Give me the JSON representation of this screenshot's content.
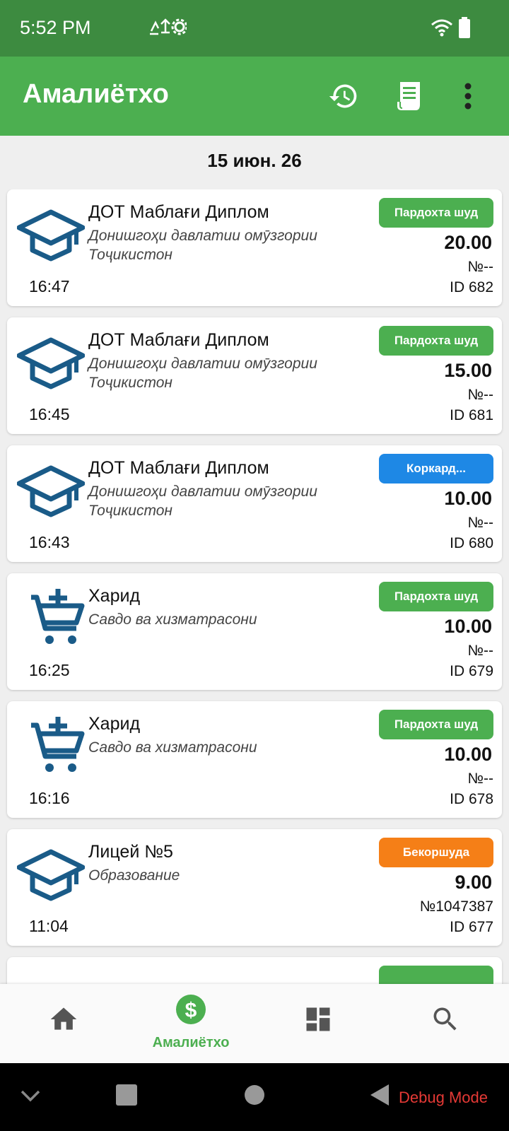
{
  "status_bar": {
    "time": "5:52 PM"
  },
  "app_bar": {
    "title": "Амалиётхо"
  },
  "date_header": "15 июн. 26",
  "colors": {
    "paid": "#4caf50",
    "processing": "#1e88e5",
    "cancelled": "#f57f17",
    "icon_blue": "#1a5b88"
  },
  "transactions": [
    {
      "icon": "graduation-cap-icon",
      "title": "ДОТ Маблағи Диплом",
      "subtitle": "Донишгоҳи давлатии омӯзгории Тоҷикистон",
      "time": "16:47",
      "status": "Пардохта шуд",
      "amount": "20.00",
      "number": "№--",
      "id": "ID 682"
    },
    {
      "icon": "graduation-cap-icon",
      "title": "ДОТ Маблағи Диплом",
      "subtitle": "Донишгоҳи давлатии омӯзгории Тоҷикистон",
      "time": "16:45",
      "status": "Пардохта шуд",
      "amount": "15.00",
      "number": "№--",
      "id": "ID 681"
    },
    {
      "icon": "graduation-cap-icon",
      "title": "ДОТ Маблағи Диплом",
      "subtitle": "Донишгоҳи давлатии омӯзгории Тоҷикистон",
      "time": "16:43",
      "status": "Коркард...",
      "amount": "10.00",
      "number": "№--",
      "id": "ID 680"
    },
    {
      "icon": "cart-plus-icon",
      "title": "Харид",
      "subtitle": "Савдо ва хизматрасони",
      "time": "16:25",
      "status": "Пардохта шуд",
      "amount": "10.00",
      "number": "№--",
      "id": "ID 679"
    },
    {
      "icon": "cart-plus-icon",
      "title": "Харид",
      "subtitle": "Савдо ва хизматрасони",
      "time": "16:16",
      "status": "Пардохта шуд",
      "amount": "10.00",
      "number": "№--",
      "id": "ID 678"
    },
    {
      "icon": "graduation-cap-icon",
      "title": "Лицей №5",
      "subtitle": "Образование",
      "time": "11:04",
      "status": "Бекоршуда",
      "amount": "9.00",
      "number": "№1047387",
      "id": "ID 677"
    }
  ],
  "bottom_nav": {
    "active_label": "Амалиётхо"
  },
  "system": {
    "debug_label": "Debug Mode"
  }
}
